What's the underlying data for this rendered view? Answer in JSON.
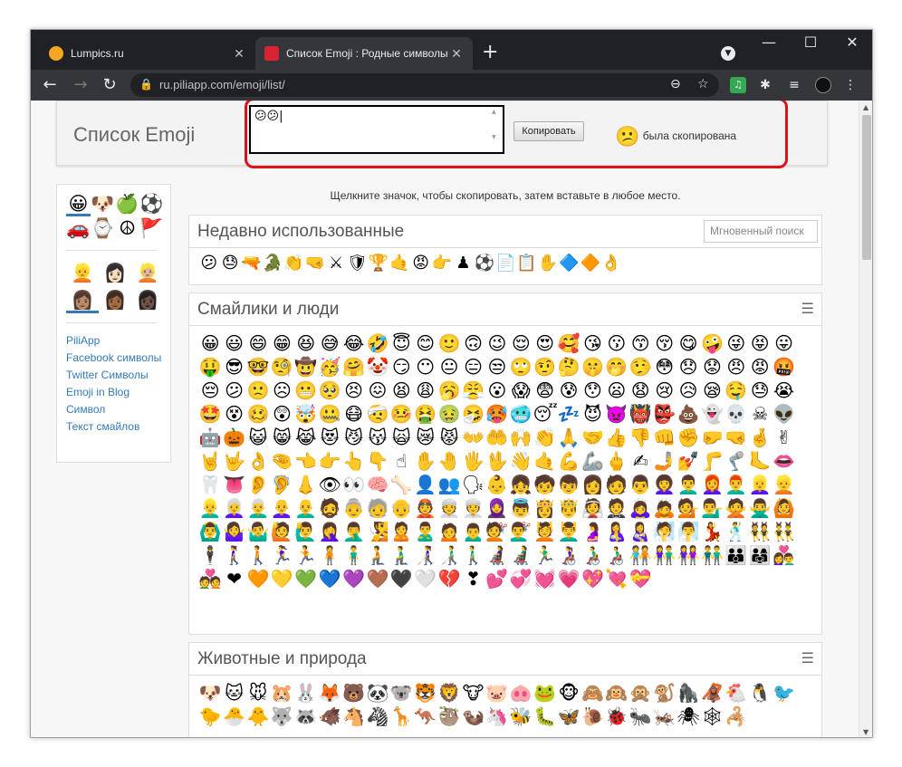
{
  "browser": {
    "tabs": [
      {
        "title": "Lumpics.ru",
        "favicon_color": "#f5a623",
        "close": "✕"
      },
      {
        "title": "Список Emoji : Родные символы",
        "favicon_color": "#d92333",
        "close": "✕"
      }
    ],
    "new_tab": "+",
    "url": "ru.piliapp.com/emoji/list/",
    "window_controls": {
      "minimize": "—",
      "maximize": "☐",
      "close": "✕"
    }
  },
  "header": {
    "title": "Список Emoji",
    "copy_box_content": "😕😕|",
    "copy_button": "Копировать",
    "copied_emoji": "😕",
    "copied_text": "была скопирована",
    "highlight_color": "#e0101a"
  },
  "sidebar": {
    "category_emojis": [
      "😀",
      "🐶",
      "🍏",
      "⚽",
      "🚗",
      "⌚",
      "☮",
      "🚩"
    ],
    "skin_emojis": [
      "👱",
      "👩🏻",
      "👱🏼",
      "👩🏽",
      "👩🏾",
      "👩🏿"
    ],
    "links": [
      "PiliApp",
      "Facebook символы",
      "Twitter Символы",
      "Emoji in Blog",
      "Символ",
      "Текст смайлов"
    ]
  },
  "main": {
    "hint": "Щелкните значок, чтобы скопировать, затем вставьте в любое место.",
    "recent": {
      "title": "Недавно использованные",
      "search_placeholder": "Мгновенный поиск",
      "emojis": [
        "😕",
        "😓",
        "🔫",
        "🐊",
        "👏",
        "🤜",
        "⚔",
        "🛡",
        "🏆",
        "🤙",
        "😡",
        "👉",
        "♟",
        "⚽",
        "📄",
        "📋",
        "✋",
        "🔷",
        "🔶",
        "👌"
      ]
    },
    "smileys": {
      "title": "Смайлики и люди",
      "menu": "☰",
      "emojis": [
        "😀",
        "😃",
        "😄",
        "😁",
        "😆",
        "😅",
        "😂",
        "🤣",
        "😇",
        "😊",
        "🙂",
        "🙃",
        "😉",
        "😌",
        "😍",
        "🥰",
        "😘",
        "😗",
        "😙",
        "😚",
        "😋",
        "🤪",
        "😜",
        "😝",
        "😛",
        "🤑",
        "😎",
        "🤓",
        "🧐",
        "🤠",
        "🥳",
        "🤗",
        "🤡",
        "😏",
        "😶",
        "😐",
        "😑",
        "😒",
        "🙄",
        "🤨",
        "🤔",
        "🤫",
        "🤭",
        "🤥",
        "😳",
        "😞",
        "😟",
        "😠",
        "😡",
        "🤬",
        "😔",
        "😕",
        "🙁",
        "☹",
        "😬",
        "🥺",
        "😣",
        "😖",
        "😫",
        "😩",
        "🥱",
        "😤",
        "😮",
        "😱",
        "😨",
        "😰",
        "😯",
        "😦",
        "😧",
        "😢",
        "😥",
        "😪",
        "🤤",
        "😓",
        "😭",
        "🤩",
        "😵",
        "🥴",
        "😲",
        "🤯",
        "🤐",
        "😷",
        "🤕",
        "🤒",
        "🤮",
        "🤢",
        "🤧",
        "🥵",
        "🥶",
        "😴",
        "💤",
        "😈",
        "👿",
        "👹",
        "👺",
        "💩",
        "👻",
        "💀",
        "☠",
        "👽",
        "🤖",
        "🎃",
        "😺",
        "😸",
        "😹",
        "😻",
        "😼",
        "😽",
        "🙀",
        "😿",
        "😾",
        "👐",
        "🤲",
        "🙌",
        "👏",
        "🙏",
        "🤝",
        "👍",
        "👎",
        "👊",
        "✊",
        "🤛",
        "🤜",
        "🤞",
        "✌",
        "🤘",
        "🤟",
        "👌",
        "🤏",
        "👈",
        "👉",
        "👆",
        "👇",
        "☝",
        "✋",
        "🤚",
        "🖐",
        "🖖",
        "👋",
        "🤙",
        "💪",
        "🦾",
        "🖕",
        "✍",
        "🤳",
        "💅",
        "🦵",
        "🦿",
        "🦶",
        "👄",
        "🦷",
        "👅",
        "👂",
        "🦻",
        "👃",
        "👁",
        "👀",
        "🧠",
        "🦴",
        "👤",
        "👥",
        "🗣",
        "👶",
        "👧",
        "🧒",
        "👦",
        "👩",
        "🧑",
        "👨",
        "👩‍🦱",
        "👨‍🦱",
        "👩‍🦰",
        "👨‍🦰",
        "👱‍♀️",
        "👱",
        "👱‍♂️",
        "👩‍🦳",
        "👨‍🦳",
        "👩‍🦲",
        "👨‍🦲",
        "🧔",
        "👵",
        "🧓",
        "👴",
        "👲",
        "👳",
        "👳‍♀️",
        "🧕",
        "👼",
        "👸",
        "🤴",
        "👰",
        "🤵",
        "🙇‍♀️",
        "🙇",
        "💁",
        "💁‍♂️",
        "🙅",
        "🙅‍♂️",
        "🙆",
        "🙆‍♂️",
        "🤷‍♀️",
        "🤷‍♂️",
        "🙋",
        "🙋‍♂️",
        "🤦‍♀️",
        "🤦‍♂️",
        "🧏",
        "🙎",
        "🙎‍♂️",
        "🙍",
        "🙍‍♂️",
        "💇",
        "💇‍♂️",
        "💆",
        "💆‍♂️",
        "🤰",
        "🤱",
        "👩‍🍼",
        "🧖",
        "🧖‍♂️",
        "💃",
        "🕺",
        "👯",
        "👯‍♂️",
        "🕴",
        "🚶‍♀️",
        "🚶",
        "🏃‍♀️",
        "🏃",
        "🧍",
        "🧍‍♂️",
        "🧎",
        "🧎‍♂️",
        "👩‍🦯",
        "👨‍🦯",
        "🚶‍♂️",
        "👩‍🦼",
        "👨‍🦼",
        "🏃‍♂️",
        "👩‍🦽",
        "👨‍🦽",
        "👨‍🦽",
        "🧑‍🤝‍🧑",
        "👫",
        "👭",
        "👬",
        "👪",
        "👨‍👩‍👧",
        "👩‍❤️‍👨",
        "💑",
        "❤",
        "🧡",
        "💛",
        "💚",
        "💙",
        "💜",
        "🤎",
        "🖤",
        "🤍",
        "💔",
        "❣",
        "💕",
        "💞",
        "💓",
        "💗",
        "💖",
        "💘",
        "💝"
      ]
    },
    "animals": {
      "title": "Животные и природа",
      "menu": "☰",
      "emojis": [
        "🐶",
        "🐱",
        "🐭",
        "🐹",
        "🐰",
        "🦊",
        "🐻",
        "🐼",
        "🐨",
        "🐯",
        "🦁",
        "🐮",
        "🐷",
        "🐽",
        "🐸",
        "🐵",
        "🙈",
        "🙉",
        "🙊",
        "🐒",
        "🦍",
        "🦧",
        "🐔",
        "🐧",
        "🐦",
        "🐤",
        "🐣",
        "🐥",
        "🐺",
        "🦝",
        "🐗",
        "🐴",
        "🦓",
        "🦒",
        "🦘",
        "🦥",
        "🦦",
        "🦄",
        "🐝",
        "🐛",
        "🦋",
        "🐌",
        "🐞",
        "🐜",
        "🦗",
        "🕷",
        "🕸",
        "🦂"
      ]
    }
  }
}
